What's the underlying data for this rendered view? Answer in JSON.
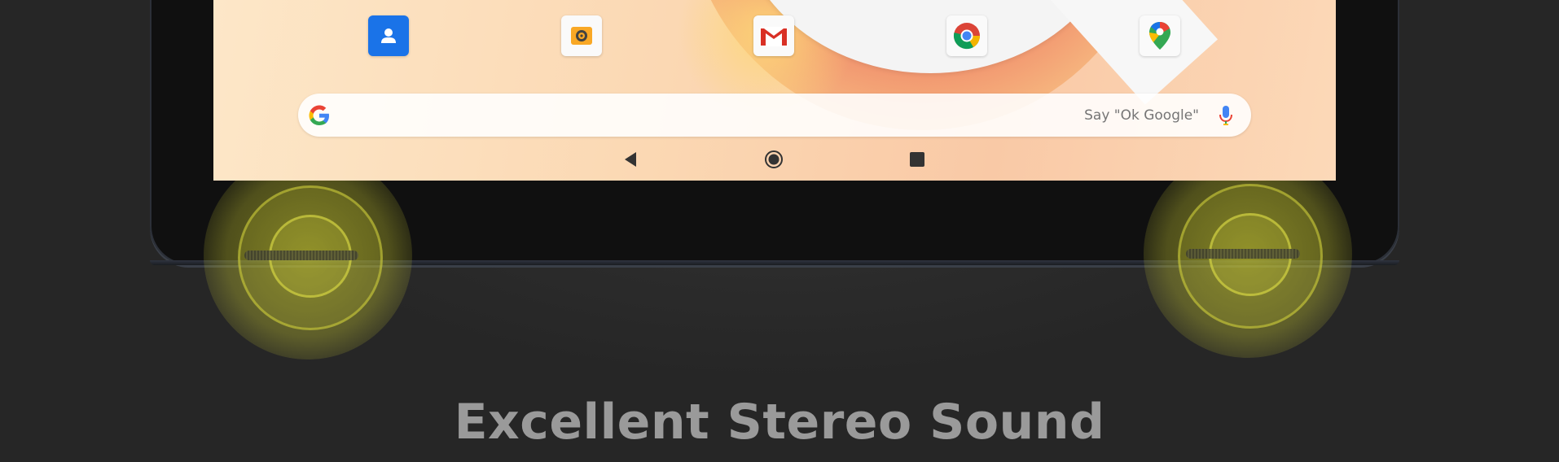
{
  "dock": {
    "apps": [
      {
        "name": "contacts-icon"
      },
      {
        "name": "camera-icon"
      },
      {
        "name": "gmail-icon"
      },
      {
        "name": "chrome-icon"
      },
      {
        "name": "maps-icon"
      }
    ]
  },
  "search": {
    "hint": "Say \"Ok Google\""
  },
  "navigation": {
    "back": "back-icon",
    "home": "home-icon",
    "recents": "recents-icon"
  },
  "headline": "Excellent Stereo Sound",
  "colors": {
    "speaker_glow": "#d9d94a",
    "headline": "#9a9a9a",
    "background": "#2a2a2a"
  }
}
